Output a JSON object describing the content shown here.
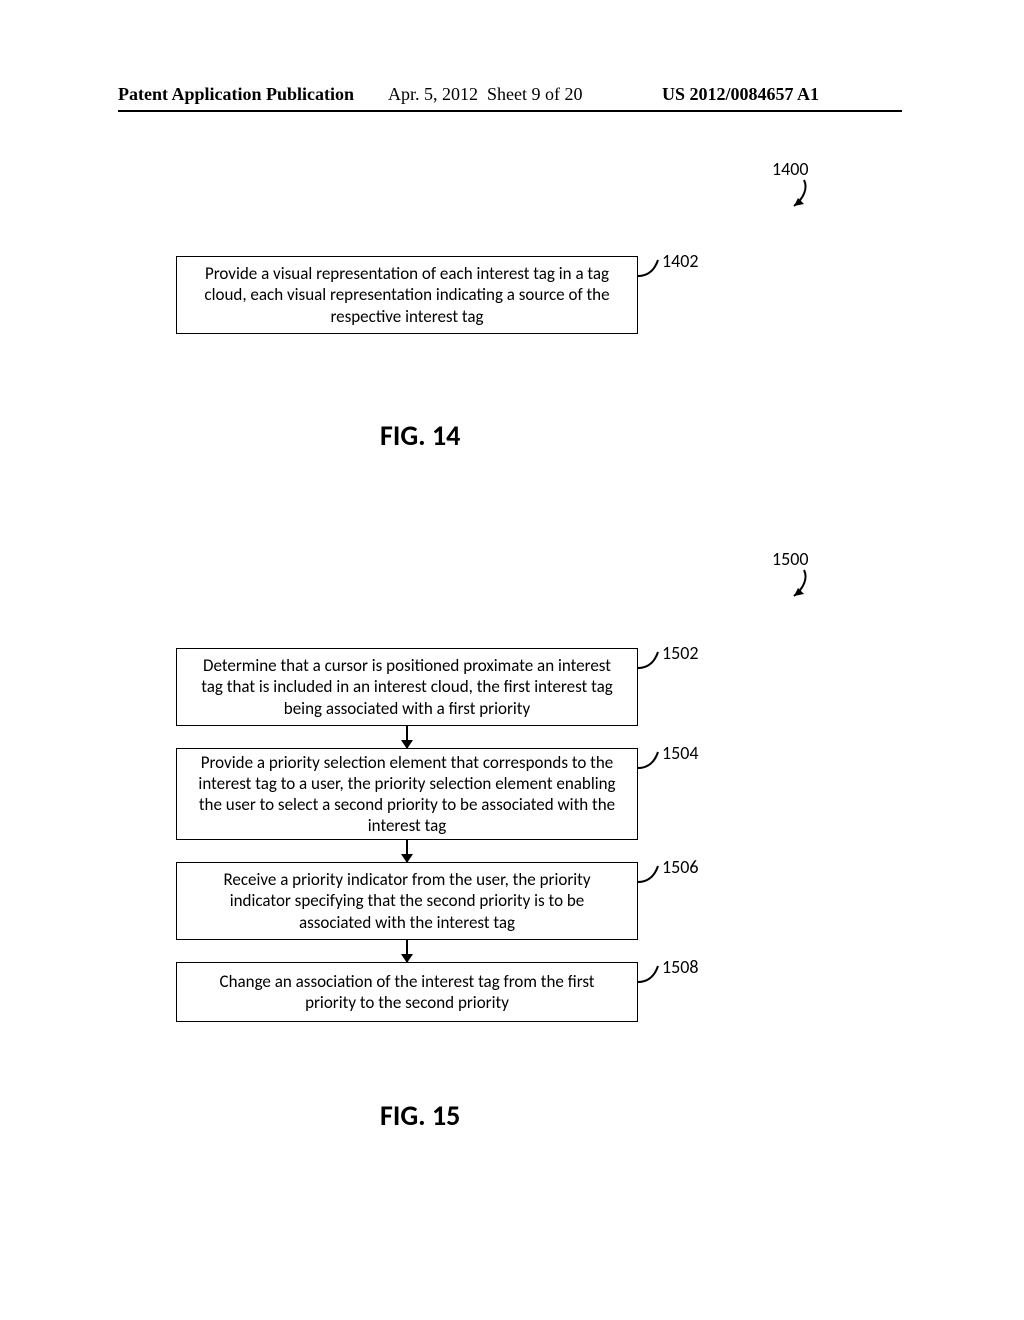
{
  "header": {
    "left": "Patent Application Publication",
    "mid_date": "Apr. 5, 2012",
    "mid_sheet": "Sheet 9 of 20",
    "right": "US 2012/0084657 A1"
  },
  "fig14": {
    "ref": "1400",
    "caption": "FIG. 14",
    "steps": [
      {
        "ref": "1402",
        "text": "Provide a visual representation of each interest tag in a tag cloud, each visual representation indicating a source of the respective interest tag"
      }
    ]
  },
  "fig15": {
    "ref": "1500",
    "caption": "FIG. 15",
    "steps": [
      {
        "ref": "1502",
        "text": "Determine that a cursor is positioned proximate an interest tag that is included in an interest cloud, the first interest tag being associated with a first priority"
      },
      {
        "ref": "1504",
        "text": "Provide a priority selection element that corresponds to the interest tag to a user, the priority selection element enabling the user to select a second priority to be associated with the interest tag"
      },
      {
        "ref": "1506",
        "text": "Receive a priority indicator from the user, the priority indicator specifying that the second priority is to be associated with the interest tag"
      },
      {
        "ref": "1508",
        "text": "Change an association of the interest tag from the first priority to the second priority"
      }
    ]
  }
}
